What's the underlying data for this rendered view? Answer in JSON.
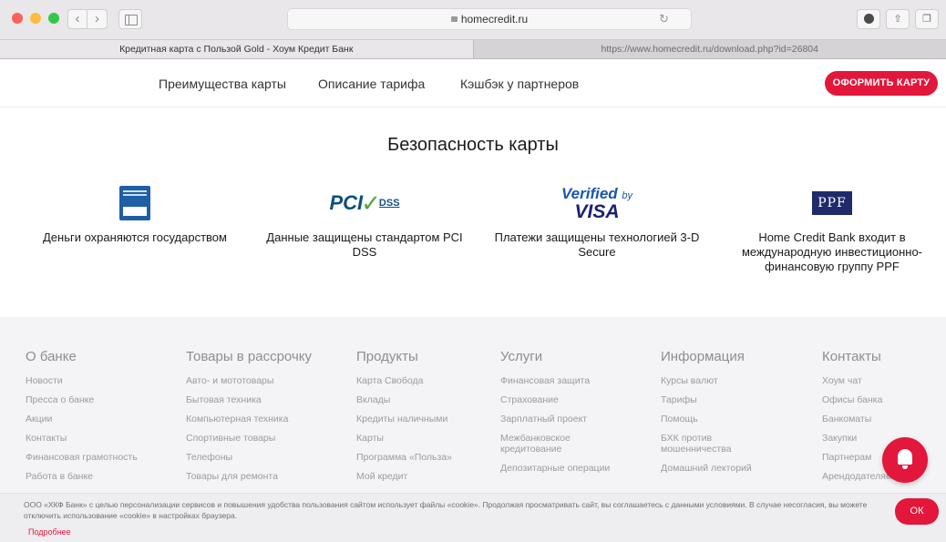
{
  "browser": {
    "address": "homecredit.ru",
    "tabs": [
      {
        "title": "Кредитная карта с Пользой Gold - Хоум Кредит Банк"
      },
      {
        "title": "https://www.homecredit.ru/download.php?id=26804"
      }
    ]
  },
  "nav": {
    "links": [
      "Преимущества карты",
      "Описание тарифа",
      "Кэшбэк у партнеров"
    ],
    "cta": "ОФОРМИТЬ КАРТУ"
  },
  "security": {
    "title": "Безопасность карты",
    "features": [
      {
        "text": "Деньги охраняются государством"
      },
      {
        "text": "Данные защищены стандартом PCI DSS",
        "logo_a": "PCI",
        "logo_b": "DSS"
      },
      {
        "text": "Платежи защищены технологией 3-D Secure",
        "logo_a": "Verified",
        "logo_by": "by",
        "logo_b": "VISA"
      },
      {
        "text": "Home Credit Bank входит в международную инвестиционно-финансовую группу PPF",
        "logo_a": "PPF"
      }
    ]
  },
  "footer": {
    "columns": [
      {
        "heading": "О банке",
        "links": [
          "Новости",
          "Пресса о банке",
          "Акции",
          "Контакты",
          "Финансовая грамотность",
          "Работа в банке"
        ]
      },
      {
        "heading": "Товары в рассрочку",
        "links": [
          "Авто- и мототовары",
          "Бытовая техника",
          "Компьютерная техника",
          "Спортивные товары",
          "Телефоны",
          "Товары для ремонта"
        ]
      },
      {
        "heading": "Продукты",
        "links": [
          "Карта Свобода",
          "Вклады",
          "Кредиты наличными",
          "Карты",
          "Программа «Польза»",
          "Мой кредит"
        ]
      },
      {
        "heading": "Услуги",
        "links": [
          "Финансовая защита",
          "Страхование",
          "Зарплатный проект",
          "Межбанковское кредитование",
          "Депозитарные операции"
        ]
      },
      {
        "heading": "Информация",
        "links": [
          "Курсы валют",
          "Тарифы",
          "Помощь",
          "БХК против мошенничества",
          "Домашний лекторий"
        ]
      },
      {
        "heading": "Контакты",
        "links": [
          "Хоум чат",
          "Офисы банка",
          "Банкоматы",
          "Закупки",
          "Партнерам",
          "Арендодателям"
        ]
      }
    ]
  },
  "cookie": {
    "text": "ООО «ХКФ Банк» с целью персонализации сервисов и повышения удобства пользования сайтом использует файлы «cookie». Продолжая просматривать сайт, вы соглашаетесь с данными условиями. В случае несогласия, вы можете отключить использование «cookie» в настройках браузера.",
    "more": "Подробнее",
    "ok": "ОК"
  },
  "colors": {
    "brand": "#e3163b"
  },
  "icons": [
    "back-icon",
    "forward-icon",
    "sidebar-icon",
    "lock-icon",
    "reload-icon",
    "download-icon",
    "share-icon",
    "tabs-icon",
    "bell-icon"
  ]
}
